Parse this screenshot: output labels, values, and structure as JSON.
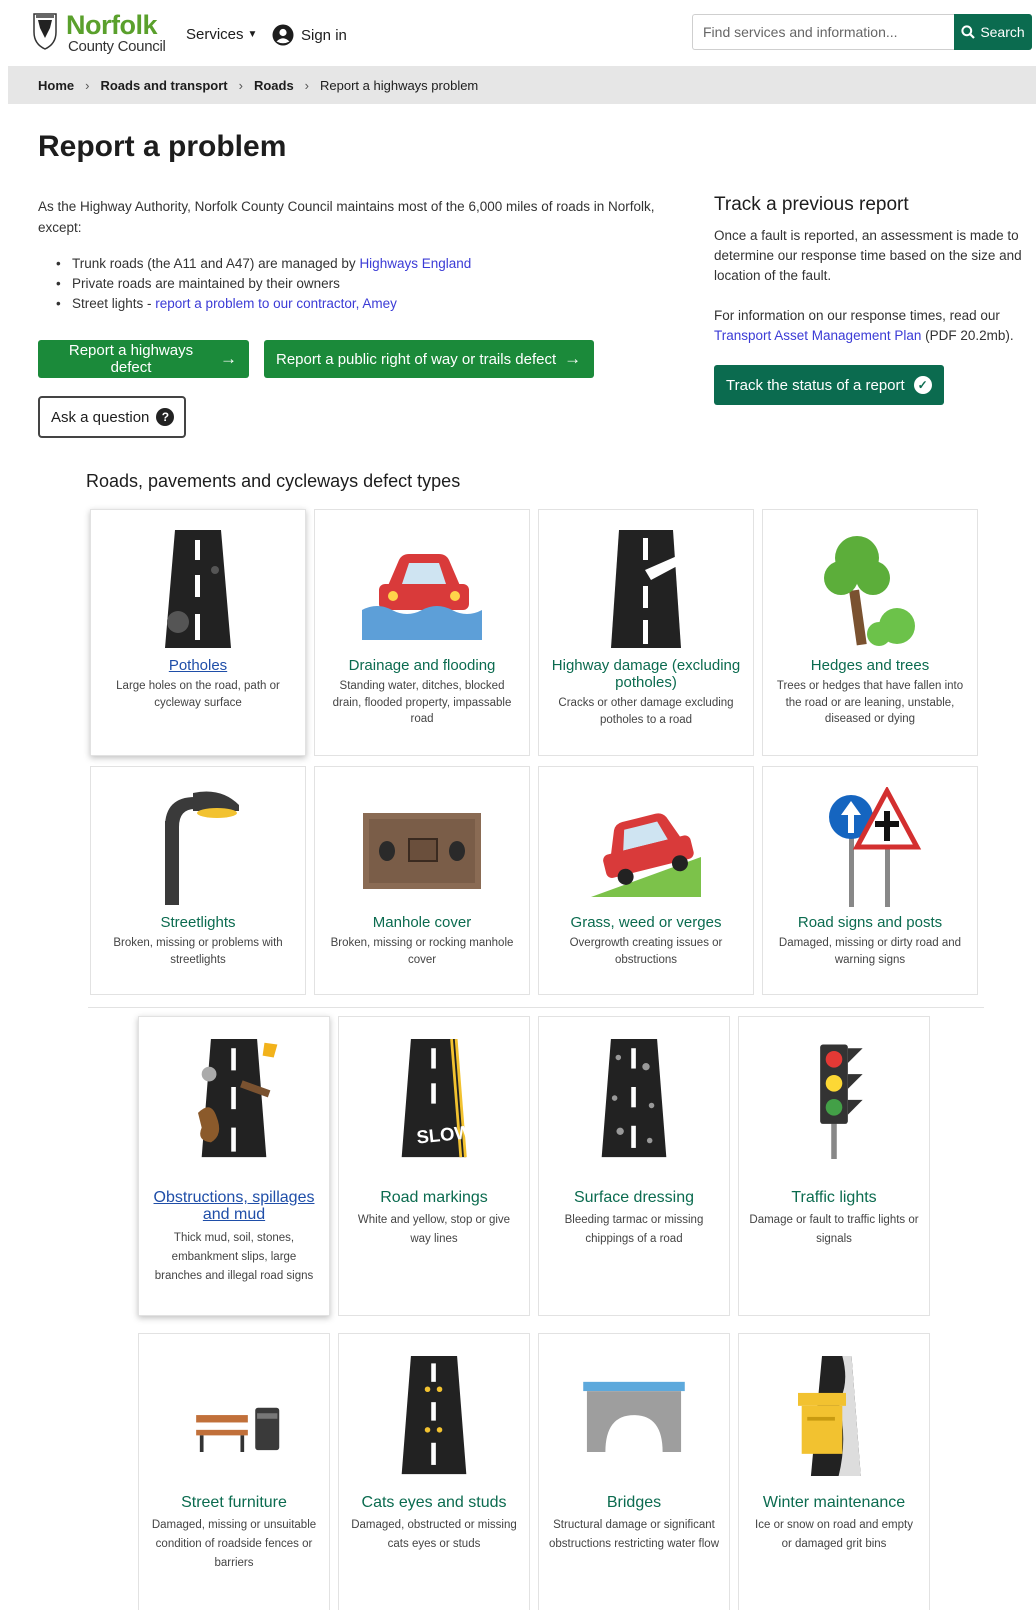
{
  "header": {
    "logo_name": "Norfolk",
    "logo_sub": "County Council",
    "services_label": "Services",
    "signin_label": "Sign in",
    "search_placeholder": "Find services and information...",
    "search_button": "Search"
  },
  "breadcrumb": [
    "Home",
    "Roads and transport",
    "Roads",
    "Report a highways problem"
  ],
  "page_title": "Report a problem",
  "intro": {
    "text": "As the Highway Authority, Norfolk County Council maintains most of the 6,000 miles of roads in Norfolk, except:",
    "items": [
      {
        "text": "Trunk roads (the A11 and A47) are managed by ",
        "link": "Highways England"
      },
      {
        "text": "Private roads are maintained by their owners",
        "link": ""
      },
      {
        "text": "Street lights - ",
        "link": "report a problem to our contractor, Amey"
      }
    ]
  },
  "buttons": {
    "highways_defect": "Report a highways defect",
    "public_right_of_way": "Report a public right of way or trails defect",
    "ask_question": "Ask a question"
  },
  "track": {
    "title": "Track a previous report",
    "text1": "Once a fault is reported, an assessment is made to determine our response time based on the size and location of the fault.",
    "text2_prefix": "For information on our response times, read our ",
    "text2_link": "Transport Asset Management Plan",
    "text2_suffix": " (PDF 20.2mb).",
    "button": "Track the status of a report"
  },
  "section_title": "Roads, pavements and cycleways defect types",
  "cards": [
    {
      "title": "Potholes",
      "desc": "Large holes on the road, path or cycleway surface",
      "icon": "pothole-road-icon"
    },
    {
      "title": "Drainage and flooding",
      "desc": "Standing water, ditches, blocked drain, flooded property, impassable road",
      "icon": "flooded-car-icon"
    },
    {
      "title": "Highway damage (excluding potholes)",
      "desc": "Cracks or other damage excluding potholes to a road",
      "icon": "cracked-road-icon"
    },
    {
      "title": "Hedges and trees",
      "desc": "Trees or hedges that have fallen into the road or are leaning, unstable, diseased or dying",
      "icon": "tree-icon"
    },
    {
      "title": "Streetlights",
      "desc": "Broken, missing or problems with streetlights",
      "icon": "streetlight-icon"
    },
    {
      "title": "Manhole cover",
      "desc": "Broken, missing or rocking manhole cover",
      "icon": "manhole-cover-icon"
    },
    {
      "title": "Grass, weed or verges",
      "desc": "Overgrowth creating issues or obstructions",
      "icon": "car-on-verge-icon"
    },
    {
      "title": "Road signs and posts",
      "desc": "Damaged, missing or dirty road and warning signs",
      "icon": "road-signs-icon"
    },
    {
      "title": "Obstructions, spillages and mud",
      "desc": "Thick mud, soil, stones, embankment slips, large branches and illegal road signs",
      "icon": "obstructed-road-icon"
    },
    {
      "title": "Road markings",
      "desc": "White and yellow, stop or give way lines",
      "icon": "road-markings-icon"
    },
    {
      "title": "Surface dressing",
      "desc": "Bleeding tarmac or missing chippings of a road",
      "icon": "surface-dressing-icon"
    },
    {
      "title": "Traffic lights",
      "desc": "Damage or fault to traffic lights or signals",
      "icon": "traffic-light-icon"
    },
    {
      "title": "Street furniture",
      "desc": "Damaged, missing or unsuitable condition of roadside fences or barriers",
      "icon": "bench-bin-icon"
    },
    {
      "title": "Cats eyes and studs",
      "desc": "Damaged, obstructed or missing cats eyes or studs",
      "icon": "cats-eyes-icon"
    },
    {
      "title": "Bridges",
      "desc": "Structural damage or significant obstructions restricting water flow",
      "icon": "bridge-icon"
    },
    {
      "title": "Winter maintenance",
      "desc": "Ice or snow on road and empty or damaged grit bins",
      "icon": "grit-bin-icon"
    }
  ]
}
